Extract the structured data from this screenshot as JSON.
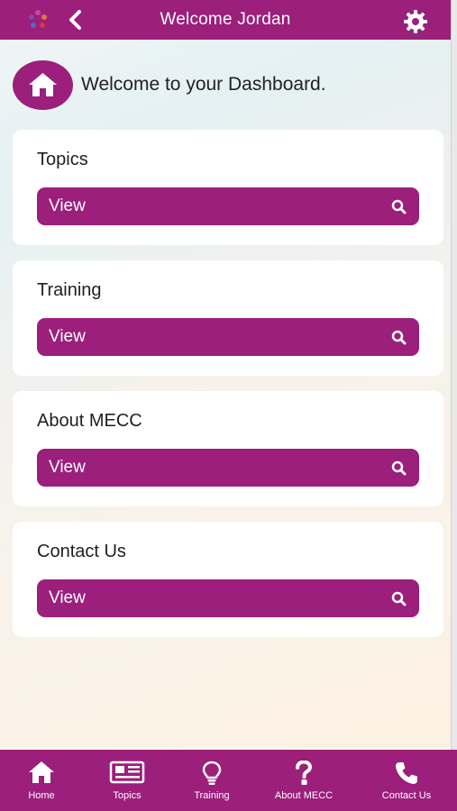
{
  "header": {
    "title": "Welcome Jordan",
    "logo_icon": "logo-icon",
    "back_icon": "chevron-left-icon",
    "settings_icon": "gear-icon",
    "brand_color": "#9b1f7b"
  },
  "welcome": {
    "icon": "home-icon",
    "text": "Welcome to your Dashboard."
  },
  "cards": [
    {
      "title": "Topics",
      "button_label": "View",
      "button_icon": "search-icon"
    },
    {
      "title": "Training",
      "button_label": "View",
      "button_icon": "search-icon"
    },
    {
      "title": "About MECC",
      "button_label": "View",
      "button_icon": "search-icon"
    },
    {
      "title": "Contact Us",
      "button_label": "View",
      "button_icon": "search-icon"
    }
  ],
  "footer_nav": [
    {
      "label": "Home",
      "icon": "home-icon"
    },
    {
      "label": "Topics",
      "icon": "newspaper-icon"
    },
    {
      "label": "Training",
      "icon": "lightbulb-icon"
    },
    {
      "label": "About MECC",
      "icon": "question-icon"
    },
    {
      "label": "Contact Us",
      "icon": "phone-icon"
    }
  ]
}
